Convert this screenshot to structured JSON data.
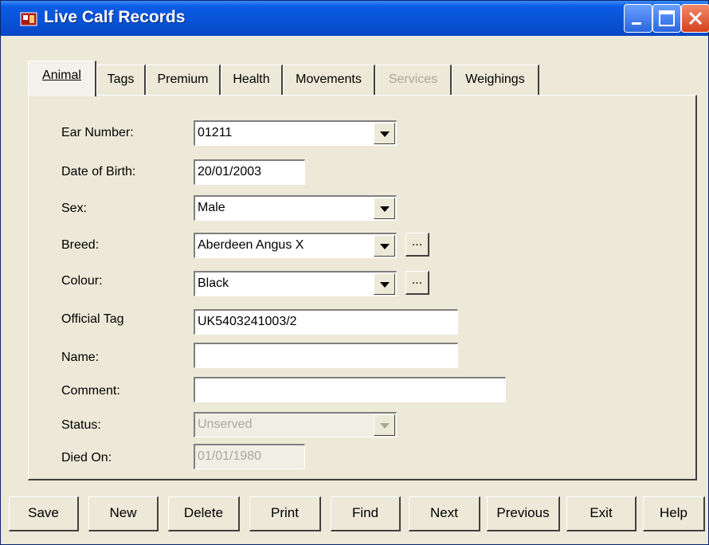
{
  "window": {
    "title": "Live Calf Records"
  },
  "tabs": [
    {
      "label": "Animal",
      "state": "active"
    },
    {
      "label": "Tags",
      "state": "normal"
    },
    {
      "label": "Premium",
      "state": "normal"
    },
    {
      "label": "Health",
      "state": "normal"
    },
    {
      "label": "Movements",
      "state": "normal"
    },
    {
      "label": "Services",
      "state": "disabled"
    },
    {
      "label": "Weighings",
      "state": "normal"
    }
  ],
  "form": {
    "ear_number": {
      "label": "Ear Number:",
      "value": "01211"
    },
    "date_of_birth": {
      "label": "Date of Birth:",
      "value": "20/01/2003"
    },
    "sex": {
      "label": "Sex:",
      "value": "Male"
    },
    "breed": {
      "label": "Breed:",
      "value": "Aberdeen Angus X",
      "more": "..."
    },
    "colour": {
      "label": "Colour:",
      "value": "Black",
      "more": "..."
    },
    "official_tag": {
      "label": "Official Tag",
      "value": "UK5403241003/2"
    },
    "name": {
      "label": "Name:",
      "value": ""
    },
    "comment": {
      "label": "Comment:",
      "value": ""
    },
    "status": {
      "label": "Status:",
      "value": "Unserved"
    },
    "died_on": {
      "label": "Died On:",
      "value": "01/01/1980"
    }
  },
  "buttons": {
    "save": "Save",
    "new": "New",
    "delete": "Delete",
    "print": "Print",
    "find": "Find",
    "next": "Next",
    "previous": "Previous",
    "exit": "Exit",
    "help": "Help"
  },
  "colors": {
    "titlebar": "#0b5ce7",
    "window_bg": "#ece9d8",
    "disabled_text": "#aca899"
  }
}
